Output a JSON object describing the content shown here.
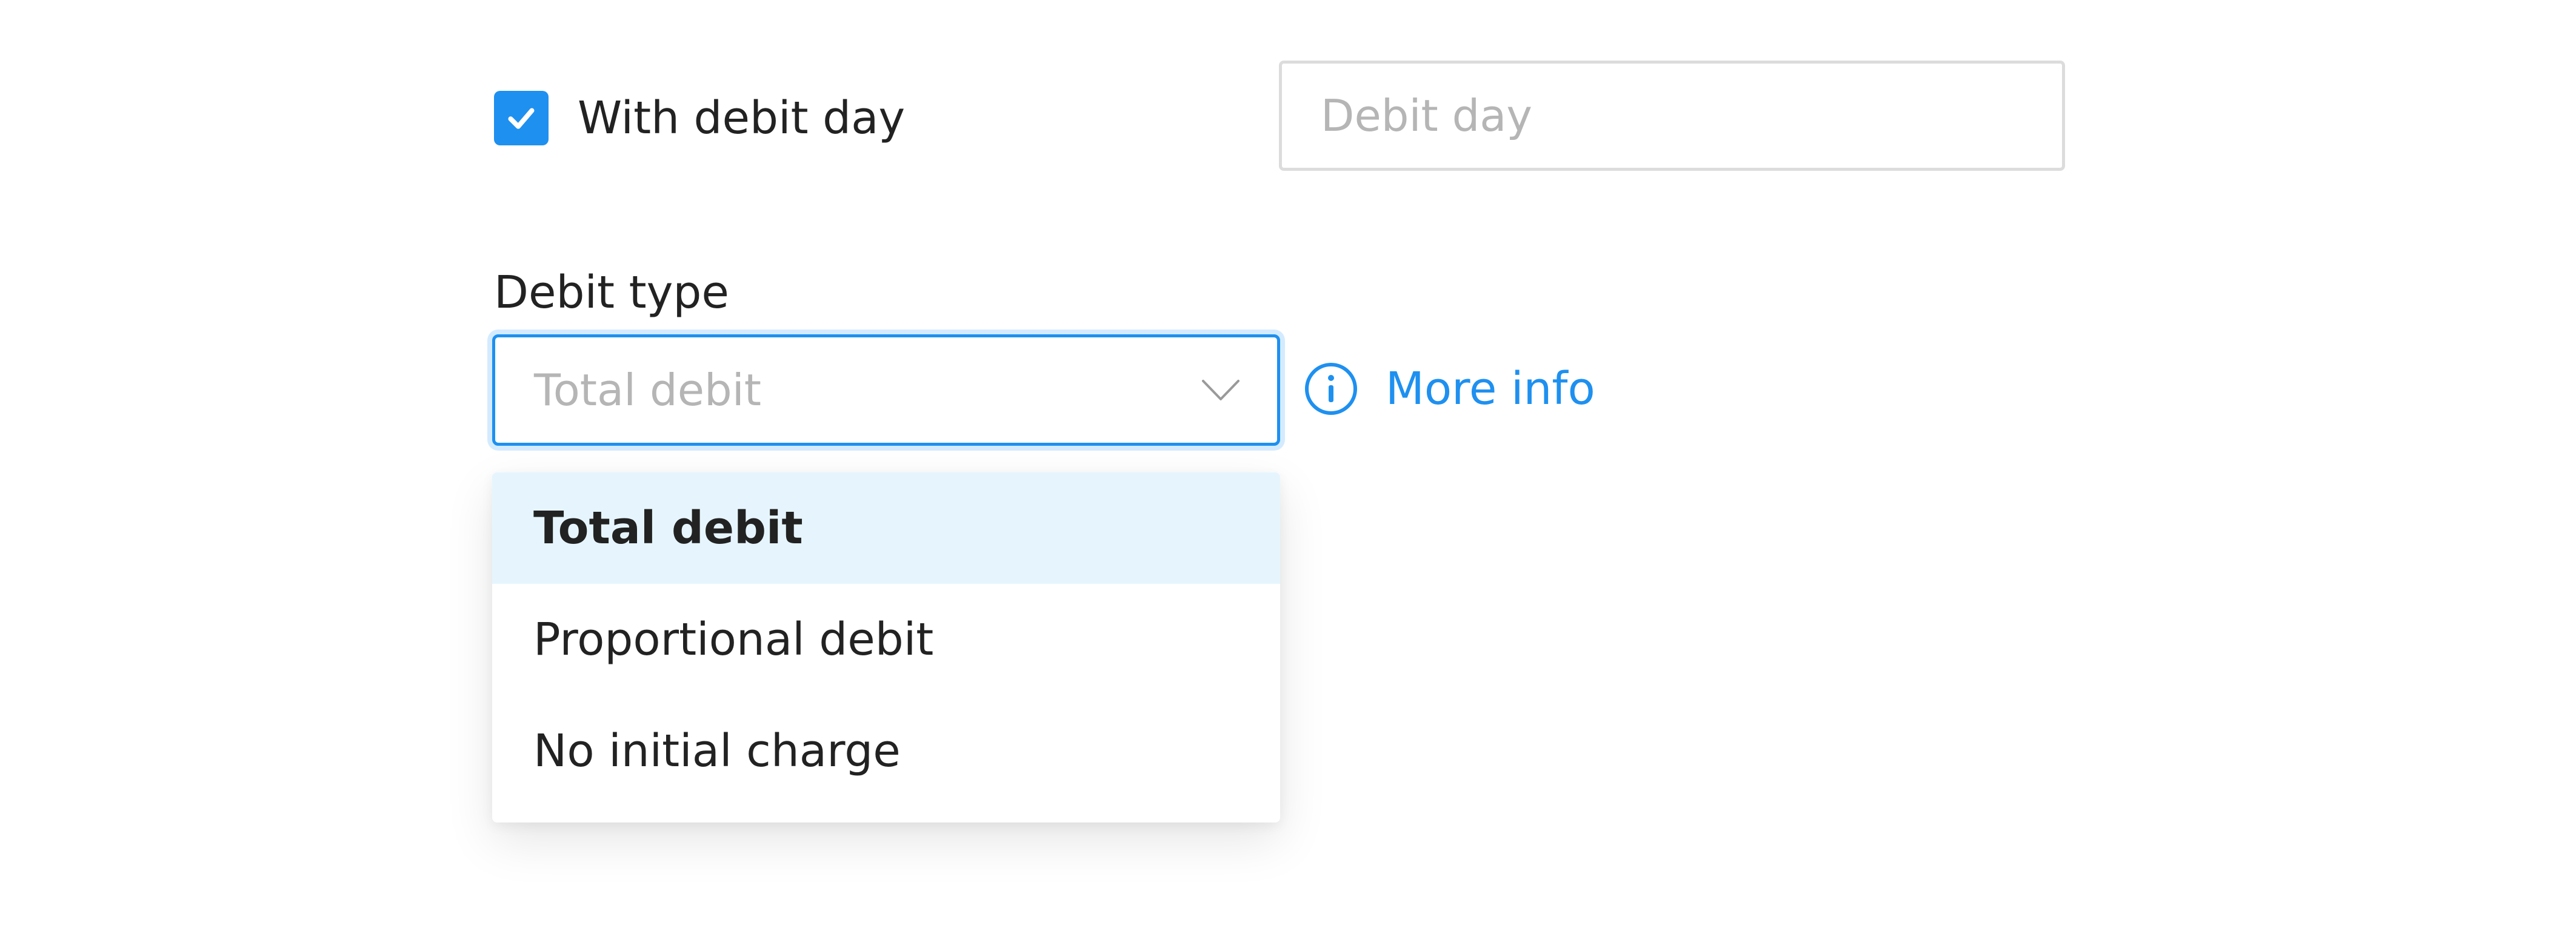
{
  "with_debit_day": {
    "checked": true,
    "label": "With debit day"
  },
  "debit_day": {
    "placeholder": "Debit day",
    "value": ""
  },
  "debit_type": {
    "label": "Debit type",
    "selected_value": "Total debit",
    "options": [
      {
        "label": "Total debit",
        "highlighted": true
      },
      {
        "label": "Proportional debit",
        "highlighted": false
      },
      {
        "label": "No initial charge",
        "highlighted": false
      }
    ]
  },
  "more_info": {
    "label": "More info"
  },
  "colors": {
    "accent": "#1e90f0",
    "highlight_bg": "#e6f5fd",
    "placeholder": "#b5b5b5",
    "text": "#222222",
    "border": "#dcdcdc"
  },
  "icons": {
    "checkbox": "check-icon",
    "chevron": "chevron-down-icon",
    "info": "info-icon"
  }
}
